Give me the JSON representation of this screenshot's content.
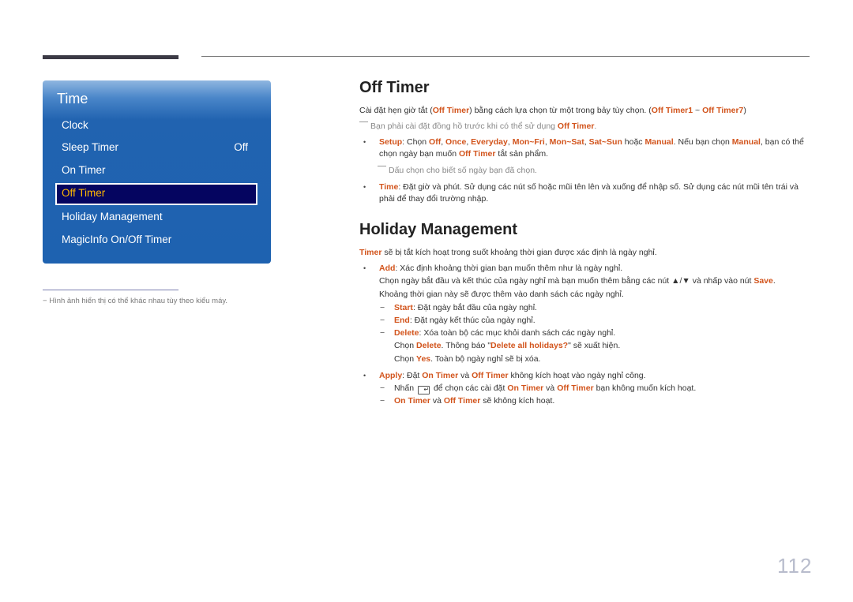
{
  "menu": {
    "title": "Time",
    "items": [
      {
        "label": "Clock",
        "value": ""
      },
      {
        "label": "Sleep Timer",
        "value": "Off"
      },
      {
        "label": "On Timer",
        "value": ""
      },
      {
        "label": "Off Timer",
        "value": "",
        "selected": true
      },
      {
        "label": "Holiday Management",
        "value": ""
      },
      {
        "label": "MagicInfo On/Off Timer",
        "value": ""
      }
    ]
  },
  "footnote": "Hình ảnh hiển thị có thể khác nhau tùy theo kiểu máy.",
  "off_timer": {
    "heading": "Off Timer",
    "intro": [
      "Cài đặt hẹn giờ tắt (",
      "Off Timer",
      ") bằng cách lựa chọn từ một trong bảy tùy chọn. (",
      "Off Timer1",
      " ~ ",
      "Off Timer7",
      ")"
    ],
    "note": [
      "Bạn phải cài đặt đồng hồ trước khi có thể sử dụng ",
      "Off Timer",
      "."
    ],
    "setup": {
      "label": "Setup",
      "text1": ": Chọn ",
      "options": [
        "Off",
        "Once",
        "Everyday",
        "Mon~Fri",
        "Mon~Sat",
        "Sat~Sun"
      ],
      "or": " hoặc ",
      "manual": "Manual",
      "text2": ". Nếu bạn chọn ",
      "text3": ", bạn có thể chọn ngày bạn muốn ",
      "off_timer": "Off Timer",
      "text4": " tắt sản phẩm.",
      "subnote": "Dấu chọn cho biết số ngày bạn đã chọn."
    },
    "time": {
      "label": "Time",
      "text": ": Đặt giờ và phút. Sử dụng các nút số hoặc mũi tên lên và xuống để nhập số. Sử dụng các nút mũi tên trái và phải để thay đổi trường nhập."
    }
  },
  "holiday": {
    "heading": "Holiday Management",
    "intro_hl": "Timer",
    "intro": " sẽ bị tắt kích hoạt trong suốt khoảng thời gian được xác định là ngày nghỉ.",
    "add": {
      "label": "Add",
      "text": ": Xác định khoảng thời gian bạn muốn thêm như là ngày nghỉ.",
      "line2a": "Chọn ngày bắt đầu và kết thúc của ngày nghỉ mà bạn muốn thêm bằng các nút ▲/▼ và nhấp vào nút ",
      "save": "Save",
      "line2b": ".",
      "line3": "Khoảng thời gian này sẽ được thêm vào danh sách các ngày nghỉ."
    },
    "start": {
      "label": "Start",
      "text": ": Đặt ngày bắt đầu của ngày nghỉ."
    },
    "end": {
      "label": "End",
      "text": ": Đặt ngày kết thúc của ngày nghỉ."
    },
    "delete": {
      "label": "Delete",
      "text": ": Xóa toàn bộ các mục khỏi danh sách các ngày nghỉ.",
      "line2a": "Chọn ",
      "line2b": ". Thông báo \"",
      "msg": "Delete all holidays?",
      "line2c": "\" sẽ xuất hiện.",
      "line3a": "Chọn ",
      "yes": "Yes",
      "line3b": ". Toàn bộ ngày nghỉ sẽ bị xóa."
    },
    "apply": {
      "label": "Apply",
      "text1": ": Đặt ",
      "on_timer": "On Timer",
      "and": " và ",
      "off_timer": "Off Timer",
      "text2": " không kích hoạt vào ngày nghỉ công.",
      "sub1a": "Nhấn ",
      "sub1b": " để chọn các cài đặt ",
      "sub1c": " bạn không muốn kích hoạt.",
      "sub2": " sẽ không kích hoạt."
    }
  },
  "page_number": "112"
}
